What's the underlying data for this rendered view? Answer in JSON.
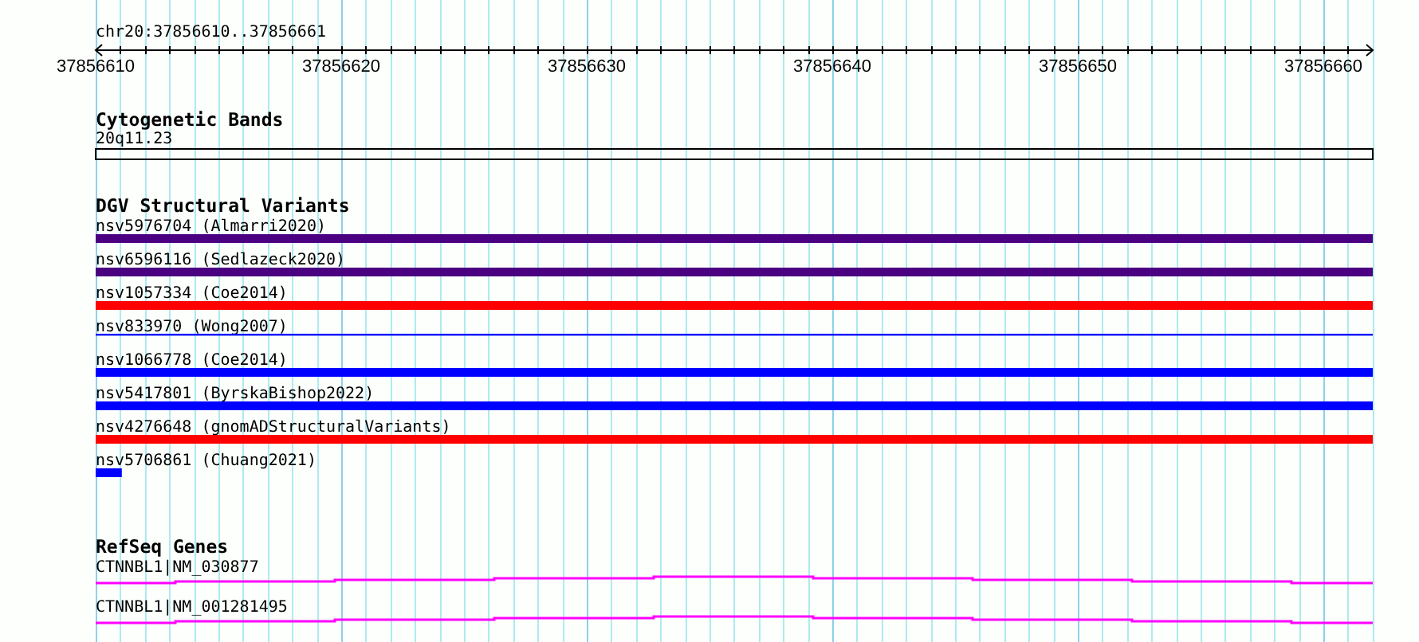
{
  "ruler": {
    "location": "chr20:37856610..37856661",
    "tick_labels": [
      "37856610",
      "37856620",
      "37856630",
      "37856640",
      "37856650",
      "37856660"
    ]
  },
  "tracks": [
    {
      "kind": "cytoband",
      "title": "Cytogenetic Bands",
      "features": [
        {
          "label": "20q11.23"
        }
      ]
    },
    {
      "kind": "variants",
      "title": "DGV Structural Variants",
      "features": [
        {
          "label": "nsv5976704 (Almarri2020)",
          "kind": "bar",
          "color": "#4b0082"
        },
        {
          "label": "nsv6596116 (Sedlazeck2020)",
          "kind": "bar",
          "color": "#4b0082"
        },
        {
          "label": "nsv1057334 (Coe2014)",
          "kind": "bar",
          "color": "#ff0000"
        },
        {
          "label": "nsv833970 (Wong2007)",
          "kind": "line",
          "color": "#0000ff"
        },
        {
          "label": "nsv1066778 (Coe2014)",
          "kind": "bar",
          "color": "#0000ff"
        },
        {
          "label": "nsv5417801 (ByrskaBishop2022)",
          "kind": "bar",
          "color": "#0000ff"
        },
        {
          "label": "nsv4276648 (gnomADStructuralVariants)",
          "kind": "bar",
          "color": "#ff0000"
        },
        {
          "label": "nsv5706861 (Chuang2021)",
          "kind": "stub",
          "color": "#0000ff"
        }
      ]
    },
    {
      "kind": "genes",
      "title": "RefSeq Genes",
      "features": [
        {
          "label": "CTNNBL1|NM_030877"
        },
        {
          "label": "CTNNBL1|NM_001281495"
        }
      ]
    }
  ]
}
